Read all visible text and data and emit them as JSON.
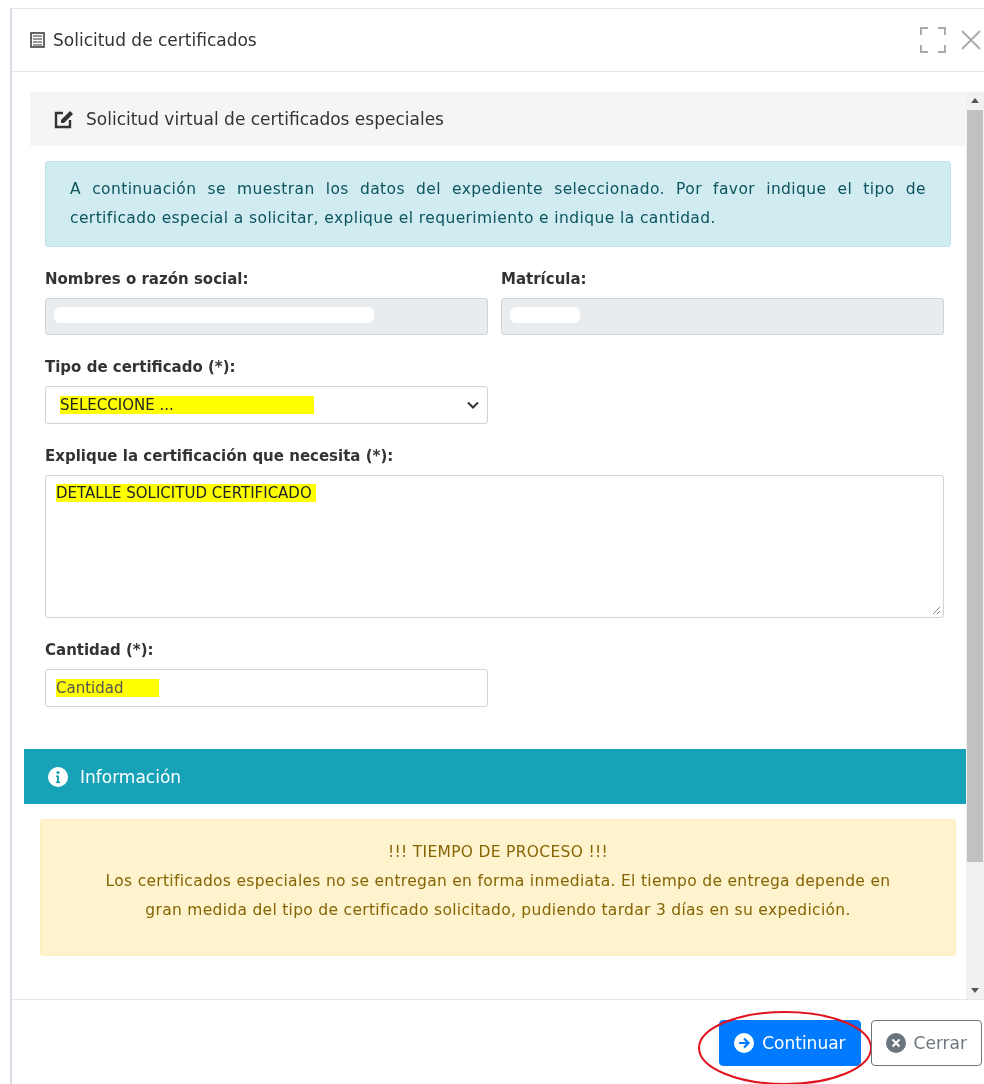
{
  "window": {
    "title": "Solicitud de certificados"
  },
  "card": {
    "title": "Solicitud virtual de certificados especiales"
  },
  "alert": {
    "text": "A continuación se muestran los datos del expediente seleccionado. Por favor indique el tipo de certificado especial a solicitar, explique el requerimiento e indique la cantidad."
  },
  "fields": [
    {
      "kind": "readonly",
      "label": "Nombres o razón social:",
      "redacted": true
    },
    {
      "kind": "readonly",
      "label": "Matrícula:",
      "redacted": true
    },
    {
      "kind": "select",
      "label": "Tipo de certificado (*):",
      "value": "SELECCIONE ...",
      "highlighted": true
    },
    {
      "kind": "textarea",
      "label": "Explique la certificación que necesita (*):",
      "value": "DETALLE SOLICITUD CERTIFICADO",
      "highlighted": true
    },
    {
      "kind": "input",
      "label": "Cantidad (*):",
      "placeholder": "Cantidad",
      "highlighted": true
    }
  ],
  "info": {
    "title": "Información",
    "heading": "!!! TIEMPO DE PROCESO !!!",
    "text": "Los certificados especiales no se entregan en forma inmediata. El tiempo de entrega depende en gran medida del tipo de certificado solicitado, pudiendo tardar 3 días en su expedición."
  },
  "buttons": [
    {
      "kind": "primary",
      "label": "Continuar",
      "circled": true
    },
    {
      "kind": "secondary",
      "label": "Cerrar",
      "circled": false
    }
  ]
}
